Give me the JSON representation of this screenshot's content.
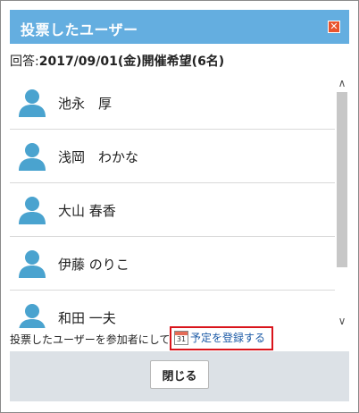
{
  "dialog": {
    "title": "投票したユーザー",
    "close_icon": "✕",
    "answer_prefix": "回答:",
    "answer_text": "2017/09/01(金)開催希望(6名)"
  },
  "users": [
    {
      "name": "池永　厚"
    },
    {
      "name": "浅岡　わかな"
    },
    {
      "name": "大山 春香"
    },
    {
      "name": "伊藤 のりこ"
    },
    {
      "name": "和田 一夫"
    }
  ],
  "scroll": {
    "up_icon": "∧",
    "down_icon": "∨"
  },
  "register": {
    "text": "投票したユーザーを参加者にして",
    "link_label": "予定を登録する",
    "calendar_number": "31"
  },
  "footer": {
    "close_label": "閉じる"
  },
  "colors": {
    "titlebar": "#64aee0",
    "avatar": "#4aa3cf",
    "highlight_box": "#d9141b",
    "link": "#1c5aa6"
  }
}
